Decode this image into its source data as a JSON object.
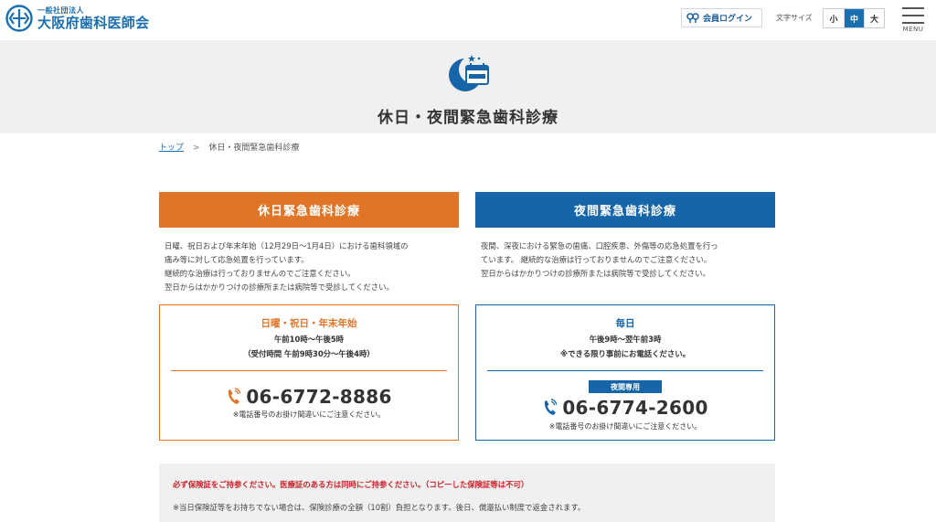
{
  "header": {
    "logo_sub": "一般社団法人",
    "logo_main": "大阪府歯科医師会",
    "login_label": "会員ログイン",
    "fontsize_label": "文字サイズ",
    "fontsize_options": [
      "小",
      "中",
      "大"
    ],
    "fontsize_selected": "中",
    "menu_label": "MENU"
  },
  "hero": {
    "title": "休日・夜間緊急歯科診療"
  },
  "breadcrumb": {
    "home": "トップ",
    "separator": ">",
    "current": "休日・夜間緊急歯科診療"
  },
  "holiday": {
    "heading": "休日緊急歯科診療",
    "description": [
      "日曜、祝日および年末年始（12月29日〜1月4日）における歯科領域の",
      "痛み等に対して応急処置を行っています。",
      "継続的な治療は行っておりませんのでご注意ください。",
      "翌日からはかかりつけの診療所または病院等で受診してください。"
    ],
    "card_title": "日曜・祝日・年末年始",
    "hours": "午前10時〜午後5時",
    "reception": "（受付時間 午前9時30分〜午後4時）",
    "phone": "06-6772-8886",
    "phone_note": "※電話番号のお掛け間違いにご注意ください。"
  },
  "night": {
    "heading": "夜間緊急歯科診療",
    "description": [
      "夜間、深夜における緊急の歯痛、口腔疾患、外傷等の応急処置を行っ",
      "ています。 継続的な治療は行っておりませんのでご注意ください。",
      "翌日からはかかりつけの診療所または病院等で受診してください。"
    ],
    "card_title": "毎日",
    "hours": "午後9時〜翌午前3時",
    "reception": "※できる限り事前にお電話ください。",
    "badge": "夜間専用",
    "phone": "06-6774-2600",
    "phone_note": "※電話番号のお掛け間違いにご注意ください。"
  },
  "notice": {
    "red": "必ず保険証をご持参ください。医療証のある方は同時にご持参ください。（コピーした保険証等は不可）",
    "gray": "※当日保険証等をお持ちでない場合は、保険診療の全額（10割）負担となります。後日、償還払い制度で返金されます。"
  },
  "colors": {
    "brand_blue": "#1a6fb0",
    "holiday_orange": "#e07527",
    "night_blue": "#1565a8",
    "notice_red": "#c8242b"
  }
}
